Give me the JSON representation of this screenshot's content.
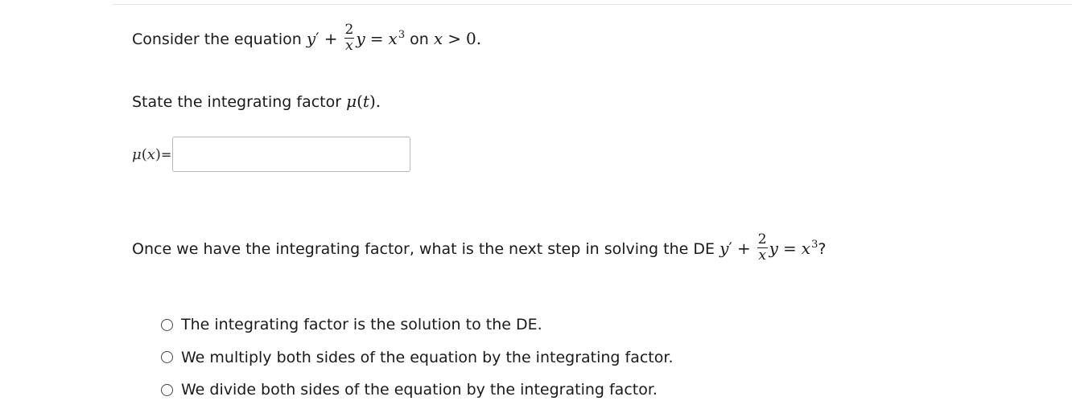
{
  "question1": {
    "prefix": "Consider the equation",
    "y_prime": "y",
    "prime": "′",
    "plus": "+",
    "frac_num": "2",
    "frac_den": "x",
    "y": "y",
    "equals": "=",
    "rhs_base": "x",
    "rhs_exp": "3",
    "on_text": "on",
    "domain_var": "x",
    "gt": ">",
    "zero": "0."
  },
  "question1_sub": {
    "text": "State the integrating factor",
    "mu": "μ",
    "arg": "(t)",
    "period": "."
  },
  "answer": {
    "mu": "μ",
    "arg_open": "(",
    "arg": "x",
    "arg_close": ")",
    "equals": "=",
    "value": "",
    "placeholder": ""
  },
  "question2": {
    "prefix": "Once we have the integrating factor, what is the next step in solving the DE",
    "y_prime": "y",
    "prime": "′",
    "plus": "+",
    "frac_num": "2",
    "frac_den": "x",
    "y": "y",
    "equals": "=",
    "rhs_base": "x",
    "rhs_exp": "3",
    "qmark": "?"
  },
  "choices": [
    {
      "label": "The integrating factor is the solution to the DE.",
      "selected": false
    },
    {
      "label": "We multiply both sides of the equation by the integrating factor.",
      "selected": false
    },
    {
      "label": "We divide both sides of the equation by the integrating factor.",
      "selected": false
    }
  ]
}
